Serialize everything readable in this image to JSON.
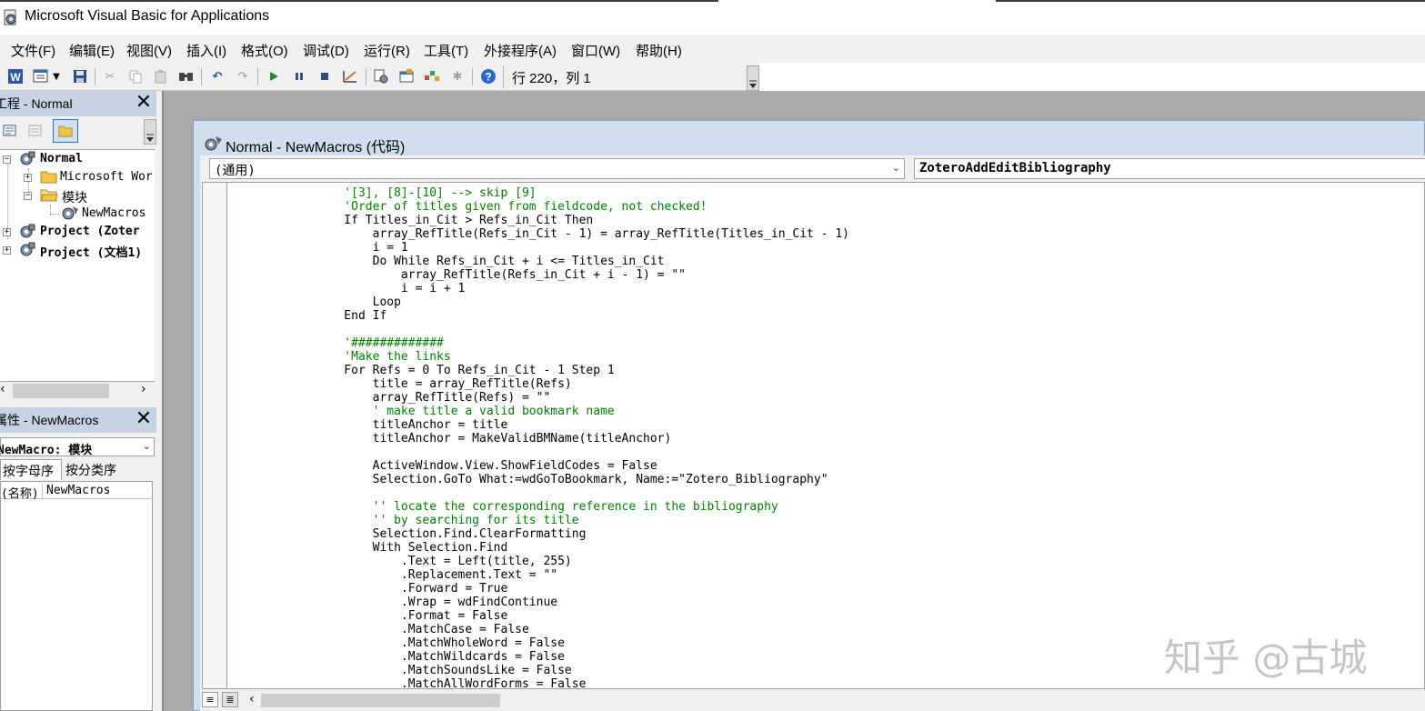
{
  "app": {
    "title": "Microsoft Visual Basic for Applications"
  },
  "menu": [
    "文件(F)",
    "编辑(E)",
    "视图(V)",
    "插入(I)",
    "格式(O)",
    "调试(D)",
    "运行(R)",
    "工具(T)",
    "外接程序(A)",
    "窗口(W)",
    "帮助(H)"
  ],
  "toolbar": {
    "position": "行 220，列 1",
    "icons": [
      "word-icon",
      "insert-module-icon",
      "save-icon",
      "cut-icon",
      "copy-icon",
      "paste-icon",
      "find-icon",
      "undo-icon",
      "redo-icon",
      "run-icon",
      "break-icon",
      "reset-icon",
      "design-mode-icon",
      "project-explorer-icon",
      "properties-icon",
      "object-browser-icon",
      "toolbox-icon",
      "help-icon"
    ]
  },
  "project_panel": {
    "title": "工程 - Normal",
    "close": "✕",
    "tree": [
      {
        "label": "Normal",
        "bold": true,
        "level": 0,
        "expander": "−"
      },
      {
        "label": "Microsoft Wor",
        "bold": false,
        "level": 1,
        "expander": "+"
      },
      {
        "label": "模块",
        "bold": false,
        "level": 1,
        "expander": "−"
      },
      {
        "label": "NewMacros",
        "bold": false,
        "level": 2,
        "expander": ""
      },
      {
        "label": "Project (Zoter",
        "bold": true,
        "level": 0,
        "expander": "+"
      },
      {
        "label": "Project (文档1)",
        "bold": true,
        "level": 0,
        "expander": "+"
      }
    ]
  },
  "properties_panel": {
    "title": "属性 - NewMacros",
    "close": "✕",
    "object_combo": "NewMacro: 模块",
    "tabs": [
      "按字母序",
      "按分类序"
    ],
    "row_name": "(名称)",
    "row_value": "NewMacros"
  },
  "code_window": {
    "title": "Normal - NewMacros (代码)",
    "object_combo": "(通用)",
    "procedure_combo": "ZoteroAddEditBibliography",
    "lines": [
      {
        "text": "    '[3], [8]-[10] --> skip [9]",
        "comment": true
      },
      {
        "text": "    'Order of titles given from fieldcode, not checked!",
        "comment": true
      },
      {
        "text": "    If Titles_in_Cit > Refs_in_Cit Then",
        "comment": false
      },
      {
        "text": "        array_RefTitle(Refs_in_Cit - 1) = array_RefTitle(Titles_in_Cit - 1)",
        "comment": false
      },
      {
        "text": "        i = 1",
        "comment": false
      },
      {
        "text": "        Do While Refs_in_Cit + i <= Titles_in_Cit",
        "comment": false
      },
      {
        "text": "            array_RefTitle(Refs_in_Cit + i - 1) = \"\"",
        "comment": false
      },
      {
        "text": "            i = i + 1",
        "comment": false
      },
      {
        "text": "        Loop",
        "comment": false
      },
      {
        "text": "    End If",
        "comment": false
      },
      {
        "text": "",
        "comment": false
      },
      {
        "text": "    '#############",
        "comment": true
      },
      {
        "text": "    'Make the links",
        "comment": true
      },
      {
        "text": "    For Refs = 0 To Refs_in_Cit - 1 Step 1",
        "comment": false
      },
      {
        "text": "        title = array_RefTitle(Refs)",
        "comment": false
      },
      {
        "text": "        array_RefTitle(Refs) = \"\"",
        "comment": false
      },
      {
        "text": "        ' make title a valid bookmark name",
        "comment": true
      },
      {
        "text": "        titleAnchor = title",
        "comment": false
      },
      {
        "text": "        titleAnchor = MakeValidBMName(titleAnchor)",
        "comment": false
      },
      {
        "text": "",
        "comment": false
      },
      {
        "text": "        ActiveWindow.View.ShowFieldCodes = False",
        "comment": false
      },
      {
        "text": "        Selection.GoTo What:=wdGoToBookmark, Name:=\"Zotero_Bibliography\"",
        "comment": false
      },
      {
        "text": "",
        "comment": false
      },
      {
        "text": "        '' locate the corresponding reference in the bibliography",
        "comment": true
      },
      {
        "text": "        '' by searching for its title",
        "comment": true
      },
      {
        "text": "        Selection.Find.ClearFormatting",
        "comment": false
      },
      {
        "text": "        With Selection.Find",
        "comment": false
      },
      {
        "text": "            .Text = Left(title, 255)",
        "comment": false
      },
      {
        "text": "            .Replacement.Text = \"\"",
        "comment": false
      },
      {
        "text": "            .Forward = True",
        "comment": false
      },
      {
        "text": "            .Wrap = wdFindContinue",
        "comment": false
      },
      {
        "text": "            .Format = False",
        "comment": false
      },
      {
        "text": "            .MatchCase = False",
        "comment": false
      },
      {
        "text": "            .MatchWholeWord = False",
        "comment": false
      },
      {
        "text": "            .MatchWildcards = False",
        "comment": false
      },
      {
        "text": "            .MatchSoundsLike = False",
        "comment": false
      },
      {
        "text": "            .MatchAllWordForms = False",
        "comment": false
      }
    ]
  },
  "watermark": "知乎 @古城",
  "colors": {
    "comment": "#008000",
    "panel_title": "#c5d3e4",
    "code_window_frame": "#cfdff0",
    "mdi_background": "#ababab"
  }
}
